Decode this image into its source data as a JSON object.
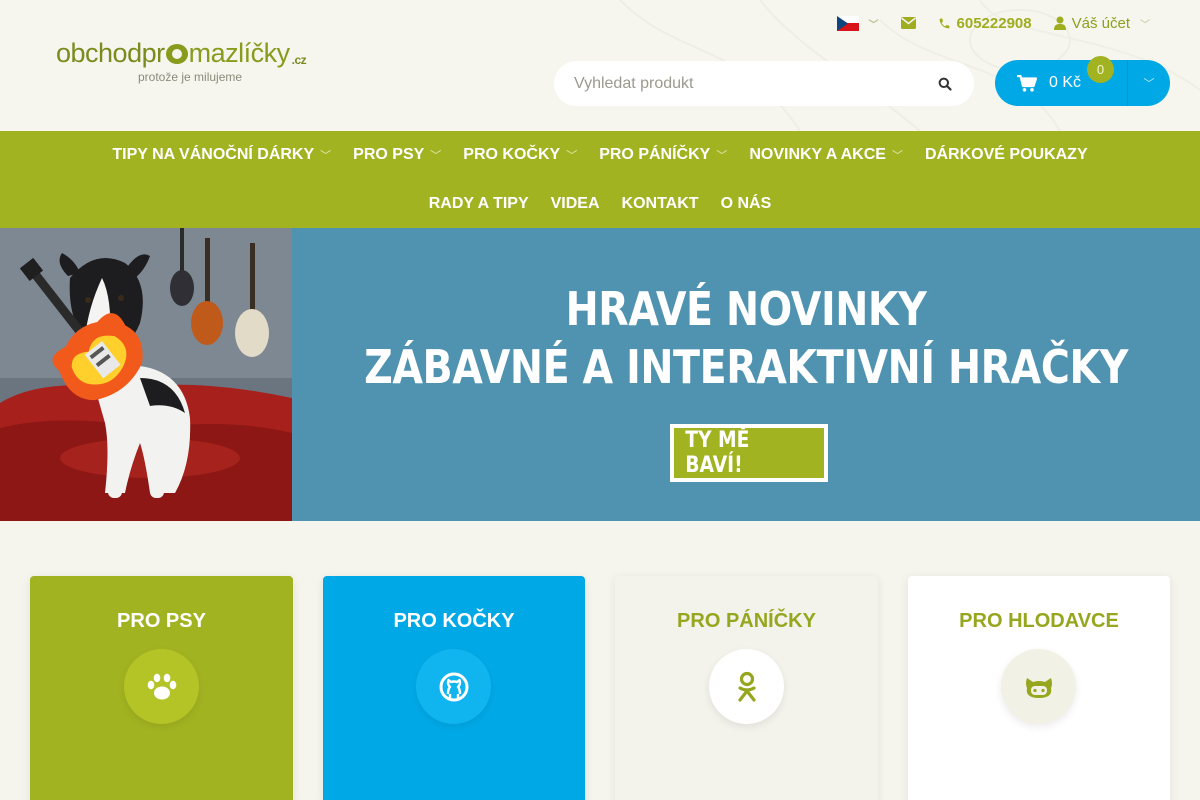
{
  "header": {
    "logo": {
      "text_part1": "obchodpr",
      "text_part2": "mazlíčky",
      "tld": ".cz",
      "tagline": "protože je milujeme"
    },
    "topbar": {
      "language": {
        "flag": "cz-flag-icon"
      },
      "email_icon": "envelope-icon",
      "phone": "605222908",
      "account": "Váš účet"
    },
    "search": {
      "placeholder": "Vyhledat produkt"
    },
    "cart": {
      "total": "0 Kč",
      "count": "0"
    }
  },
  "nav": {
    "row1": [
      {
        "label": "TIPY NA VÁNOČNÍ DÁRKY",
        "has_dropdown": true
      },
      {
        "label": "PRO PSY",
        "has_dropdown": true
      },
      {
        "label": "PRO KOČKY",
        "has_dropdown": true
      },
      {
        "label": "PRO PÁNÍČKY",
        "has_dropdown": true
      },
      {
        "label": "NOVINKY A AKCE",
        "has_dropdown": true
      },
      {
        "label": "DÁRKOVÉ POUKAZY",
        "has_dropdown": false
      }
    ],
    "row2": [
      {
        "label": "RADY A TIPY"
      },
      {
        "label": "VIDEA"
      },
      {
        "label": "KONTAKT"
      },
      {
        "label": "O NÁS"
      }
    ]
  },
  "banner": {
    "title_line1": "HRAVÉ NOVINKY",
    "title_line2": "ZÁBAVNÉ A INTERAKTIVNÍ HRAČKY",
    "button": "TY MĚ BAVÍ!"
  },
  "categories": [
    {
      "title": "PRO PSY",
      "icon": "paw-icon",
      "color": "#a2b321"
    },
    {
      "title": "PRO KOČKY",
      "icon": "cat-icon",
      "color": "#00a9e6"
    },
    {
      "title": "PRO PÁNÍČKY",
      "icon": "person-icon",
      "color": "#f3f3ec"
    },
    {
      "title": "PRO HLODAVCE",
      "icon": "rodent-icon",
      "color": "#ffffff"
    }
  ],
  "colors": {
    "brand_green": "#a2b321",
    "brand_blue": "#00a9e6",
    "banner_blue": "#4f93b1"
  }
}
